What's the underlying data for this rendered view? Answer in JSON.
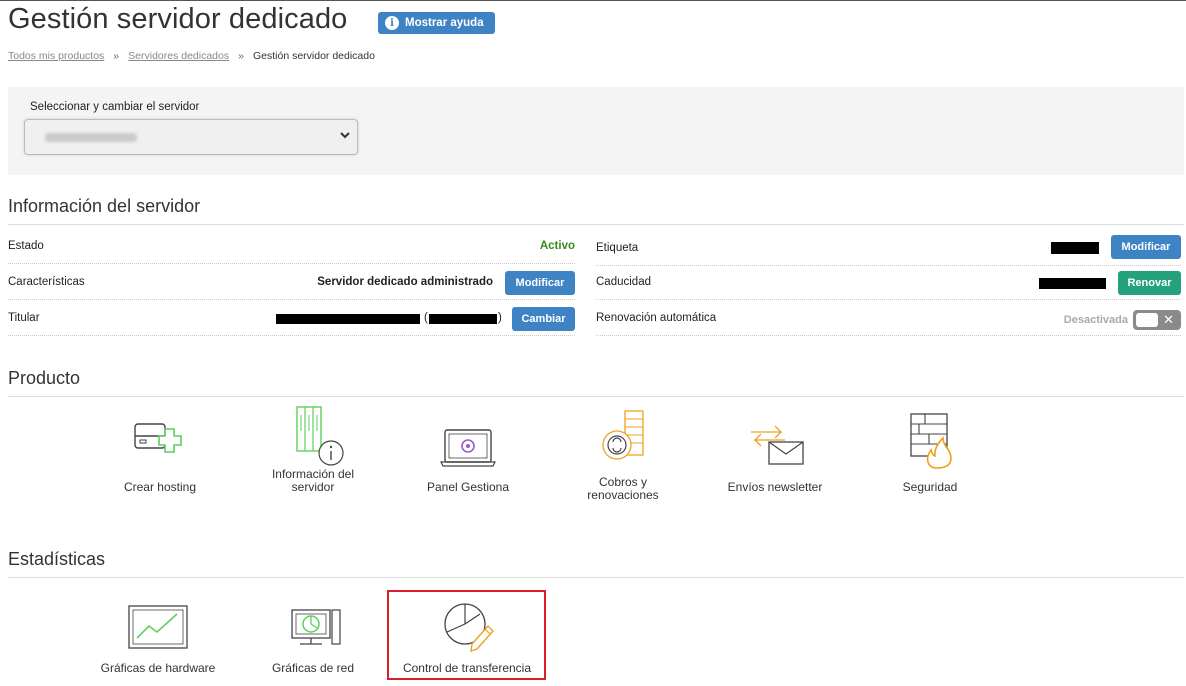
{
  "header": {
    "title": "Gestión servidor dedicado",
    "help_button": "Mostrar ayuda"
  },
  "breadcrumb": {
    "items": [
      "Todos mis productos",
      "Servidores dedicados",
      "Gestión servidor dedicado"
    ],
    "separator": "»"
  },
  "server_selector": {
    "label": "Seleccionar y cambiar el servidor"
  },
  "server_info": {
    "title": "Información del servidor",
    "estado": {
      "label": "Estado",
      "value": "Activo"
    },
    "caracteristicas": {
      "label": "Características",
      "value": "Servidor dedicado administrado",
      "button": "Modificar"
    },
    "titular": {
      "label": "Titular",
      "paren_open": "(",
      "paren_close": ")",
      "button": "Cambiar"
    },
    "etiqueta": {
      "label": "Etiqueta",
      "button": "Modificar"
    },
    "caducidad": {
      "label": "Caducidad",
      "button": "Renovar"
    },
    "renovacion": {
      "label": "Renovación automática",
      "value": "Desactivada",
      "toggle_state": "off",
      "toggle_mark": "✕"
    }
  },
  "producto": {
    "title": "Producto",
    "tiles": [
      {
        "label": "Crear hosting",
        "icon": "server-add-icon"
      },
      {
        "label": "Información del servidor",
        "icon": "server-info-icon"
      },
      {
        "label": "Panel Gestiona",
        "icon": "laptop-panel-icon"
      },
      {
        "label": "Cobros y renovaciones",
        "icon": "coins-renew-icon"
      },
      {
        "label": "Envíos newsletter",
        "icon": "newsletter-icon"
      },
      {
        "label": "Seguridad",
        "icon": "firewall-icon"
      }
    ]
  },
  "estadisticas": {
    "title": "Estadísticas",
    "tiles": [
      {
        "label": "Gráficas de hardware",
        "icon": "hardware-chart-icon"
      },
      {
        "label": "Gráficas de red",
        "icon": "network-chart-icon"
      },
      {
        "label": "Control de transferencia",
        "icon": "transfer-pie-icon",
        "highlighted": true
      }
    ]
  },
  "colors": {
    "accent_blue": "#3e84c4",
    "accent_green": "#26a17e",
    "status_active": "#3a8a1f",
    "icon_green": "#5ccf5c",
    "icon_orange": "#f0a020",
    "icon_purple": "#9a5cc8",
    "highlight_red": "#d9202a"
  }
}
